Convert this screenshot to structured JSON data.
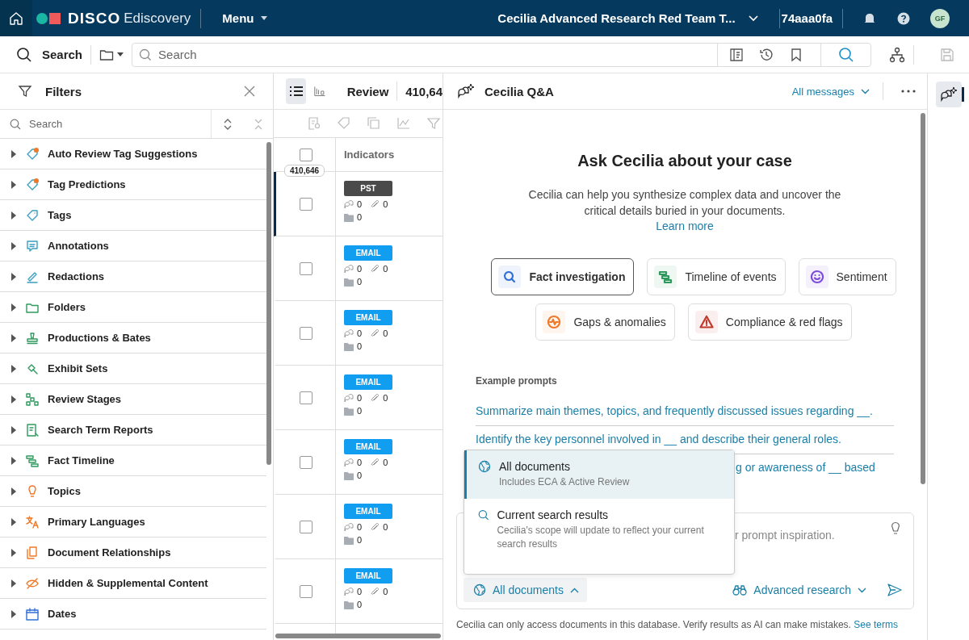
{
  "topbar": {
    "brand": "DISCO",
    "product": "Ediscovery",
    "menu": "Menu",
    "case_title": "Cecilia Advanced Research Red Team T...",
    "database": "74aaa0fa",
    "avatar": "GF"
  },
  "search_bar": {
    "label": "Search",
    "placeholder": "Search"
  },
  "filters": {
    "title": "Filters",
    "search_placeholder": "Search",
    "items": [
      {
        "label": "Auto Review Tag Suggestions",
        "expanded": false
      },
      {
        "label": "Tag Predictions",
        "expanded": false
      },
      {
        "label": "Tags",
        "expanded": false
      },
      {
        "label": "Annotations",
        "expanded": false
      },
      {
        "label": "Redactions",
        "expanded": false
      },
      {
        "label": "Folders",
        "expanded": false
      },
      {
        "label": "Productions & Bates",
        "expanded": false
      },
      {
        "label": "Exhibit Sets",
        "expanded": false
      },
      {
        "label": "Review Stages",
        "expanded": false
      },
      {
        "label": "Search Term Reports",
        "expanded": false
      },
      {
        "label": "Fact Timeline",
        "expanded": false
      },
      {
        "label": "Topics",
        "expanded": false
      },
      {
        "label": "Primary Languages",
        "expanded": false
      },
      {
        "label": "Document Relationships",
        "expanded": false
      },
      {
        "label": "Hidden & Supplemental Content",
        "expanded": false
      },
      {
        "label": "Dates",
        "expanded": false
      }
    ]
  },
  "review": {
    "title": "Review",
    "count": "410,64",
    "count_tooltip": "410,646",
    "column": "Indicators",
    "select_all": {
      "checked": false
    },
    "rows": [
      {
        "type": "PST",
        "kind": "pst",
        "comments": "0",
        "attachments": "0",
        "folders": "0",
        "checked": false,
        "selected": true
      },
      {
        "type": "EMAIL",
        "kind": "email",
        "comments": "0",
        "attachments": "0",
        "folders": "0",
        "checked": false,
        "selected": false
      },
      {
        "type": "EMAIL",
        "kind": "email",
        "comments": "0",
        "attachments": "0",
        "folders": "0",
        "checked": false,
        "selected": false
      },
      {
        "type": "EMAIL",
        "kind": "email",
        "comments": "0",
        "attachments": "0",
        "folders": "0",
        "checked": false,
        "selected": false
      },
      {
        "type": "EMAIL",
        "kind": "email",
        "comments": "0",
        "attachments": "0",
        "folders": "0",
        "checked": false,
        "selected": false
      },
      {
        "type": "EMAIL",
        "kind": "email",
        "comments": "0",
        "attachments": "0",
        "folders": "0",
        "checked": false,
        "selected": false
      },
      {
        "type": "EMAIL",
        "kind": "email",
        "comments": "0",
        "attachments": "0",
        "folders": "0",
        "checked": false,
        "selected": false
      }
    ]
  },
  "qa": {
    "title": "Cecilia Q&A",
    "message_filter": "All messages",
    "heading": "Ask Cecilia about your case",
    "intro": "Cecilia can help you synthesize complex data and uncover the critical details buried in your documents.",
    "learn_more": "Learn more",
    "modes": [
      {
        "label": "Fact investigation",
        "selected": true,
        "color": "#2f6fd6"
      },
      {
        "label": "Timeline of events",
        "selected": false,
        "color": "#2e9a5e"
      },
      {
        "label": "Sentiment",
        "selected": false,
        "color": "#7c4ddb"
      },
      {
        "label": "Gaps & anomalies",
        "selected": false,
        "color": "#f07a2a"
      },
      {
        "label": "Compliance & red flags",
        "selected": false,
        "color": "#c0392b"
      }
    ],
    "examples_title": "Example prompts",
    "prompts": [
      {
        "text": "Summarize main themes, topics, and frequently discussed issues regarding __.",
        "kind": "full"
      },
      {
        "text": "Identify the key personnel involved in __ and describe their general roles.",
        "kind": "full"
      },
      {
        "text": "g or awareness of __ based",
        "kind": "partial"
      }
    ],
    "input_placeholder": "r prompt inspiration.",
    "scope": "All documents",
    "research": "Advanced research",
    "scope_menu": [
      {
        "title": "All documents",
        "note": "Includes ECA & Active Review",
        "selected": true
      },
      {
        "title": "Current search results",
        "note": "Cecilia's scope will update to reflect your current search results",
        "selected": false
      }
    ],
    "disclaimer": "Cecilia can only access documents in this database. Verify results as AI can make mistakes.",
    "terms": "See terms"
  }
}
